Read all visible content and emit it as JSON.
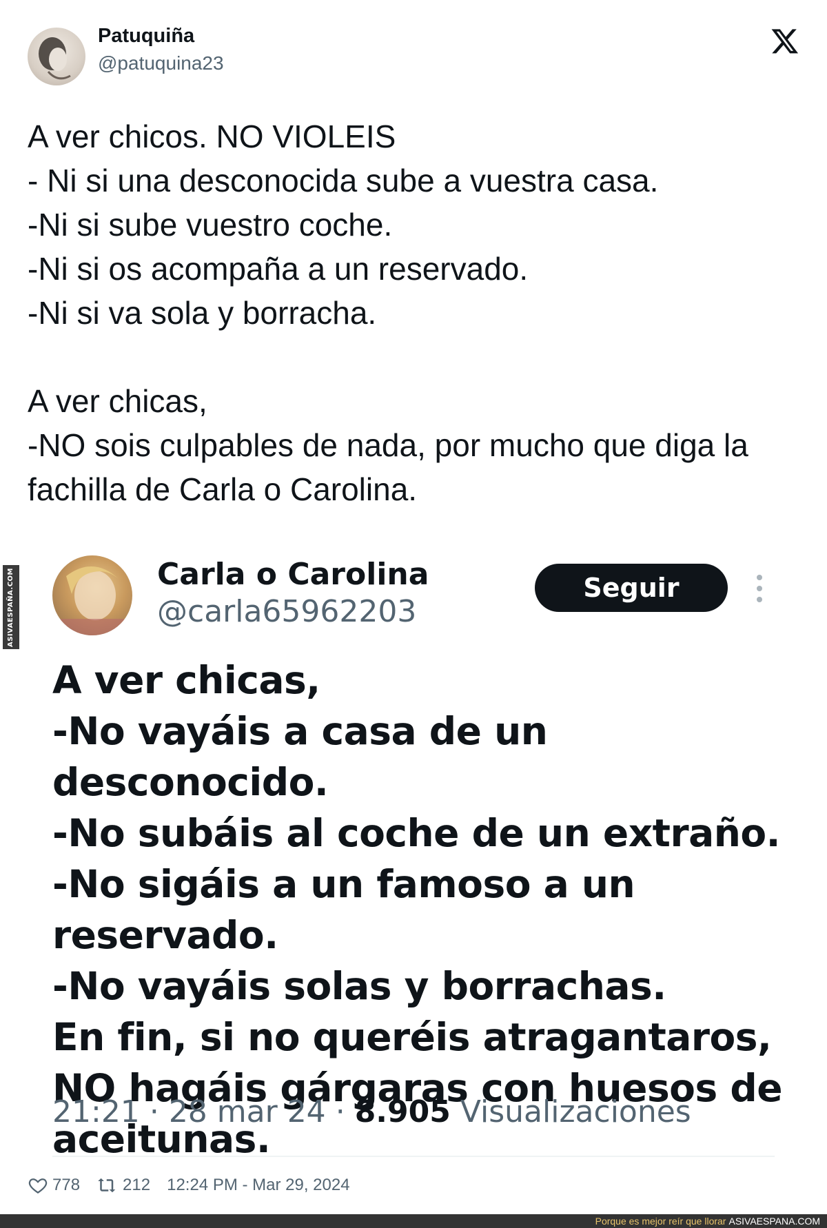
{
  "tweet": {
    "author_name": "Patuquiña",
    "author_handle": "@patuquina23",
    "text": "A ver chicos. NO VIOLEIS\n- Ni si una desconocida sube a vuestra casa.\n-Ni si sube vuestro coche.\n-Ni si os acompaña a un reservado.\n-Ni si va sola y borracha.\n\nA ver chicas,\n-NO sois culpables de nada, por mucho que diga la fachilla de Carla o Carolina.",
    "likes": "778",
    "retweets": "212",
    "timestamp": "12:24 PM - Mar 29, 2024",
    "icons": {
      "logo": "x-logo-icon",
      "like": "heart-icon",
      "retweet": "retweet-icon"
    }
  },
  "embedded": {
    "author_name": "Carla o Carolina",
    "author_handle": "@carla65962203",
    "follow_label": "Seguir",
    "text": "A ver chicas,\n-No vayáis a casa de un desconocido.\n-No subáis al coche de un extraño.\n-No sigáis a un famoso a un reservado.\n-No vayáis solas y borrachas.\nEn fin, si no queréis atragantaros,\nNO hagáis gárgaras con huesos de aceitunas.",
    "time": "21:21",
    "date": "28 mar 24",
    "views_count": "8.905",
    "views_label": "Visualizaciones",
    "separator": "·"
  },
  "watermark": "ASIVAESPAÑA.COM",
  "footer": {
    "tagline": "Porque es mejor reír que llorar",
    "site": "ASIVAESPANA.COM"
  },
  "colors": {
    "text": "#0f1419",
    "muted": "#536471",
    "button": "#0f1419",
    "footer_bar": "#333333",
    "footer_accent": "#e8c36a"
  }
}
